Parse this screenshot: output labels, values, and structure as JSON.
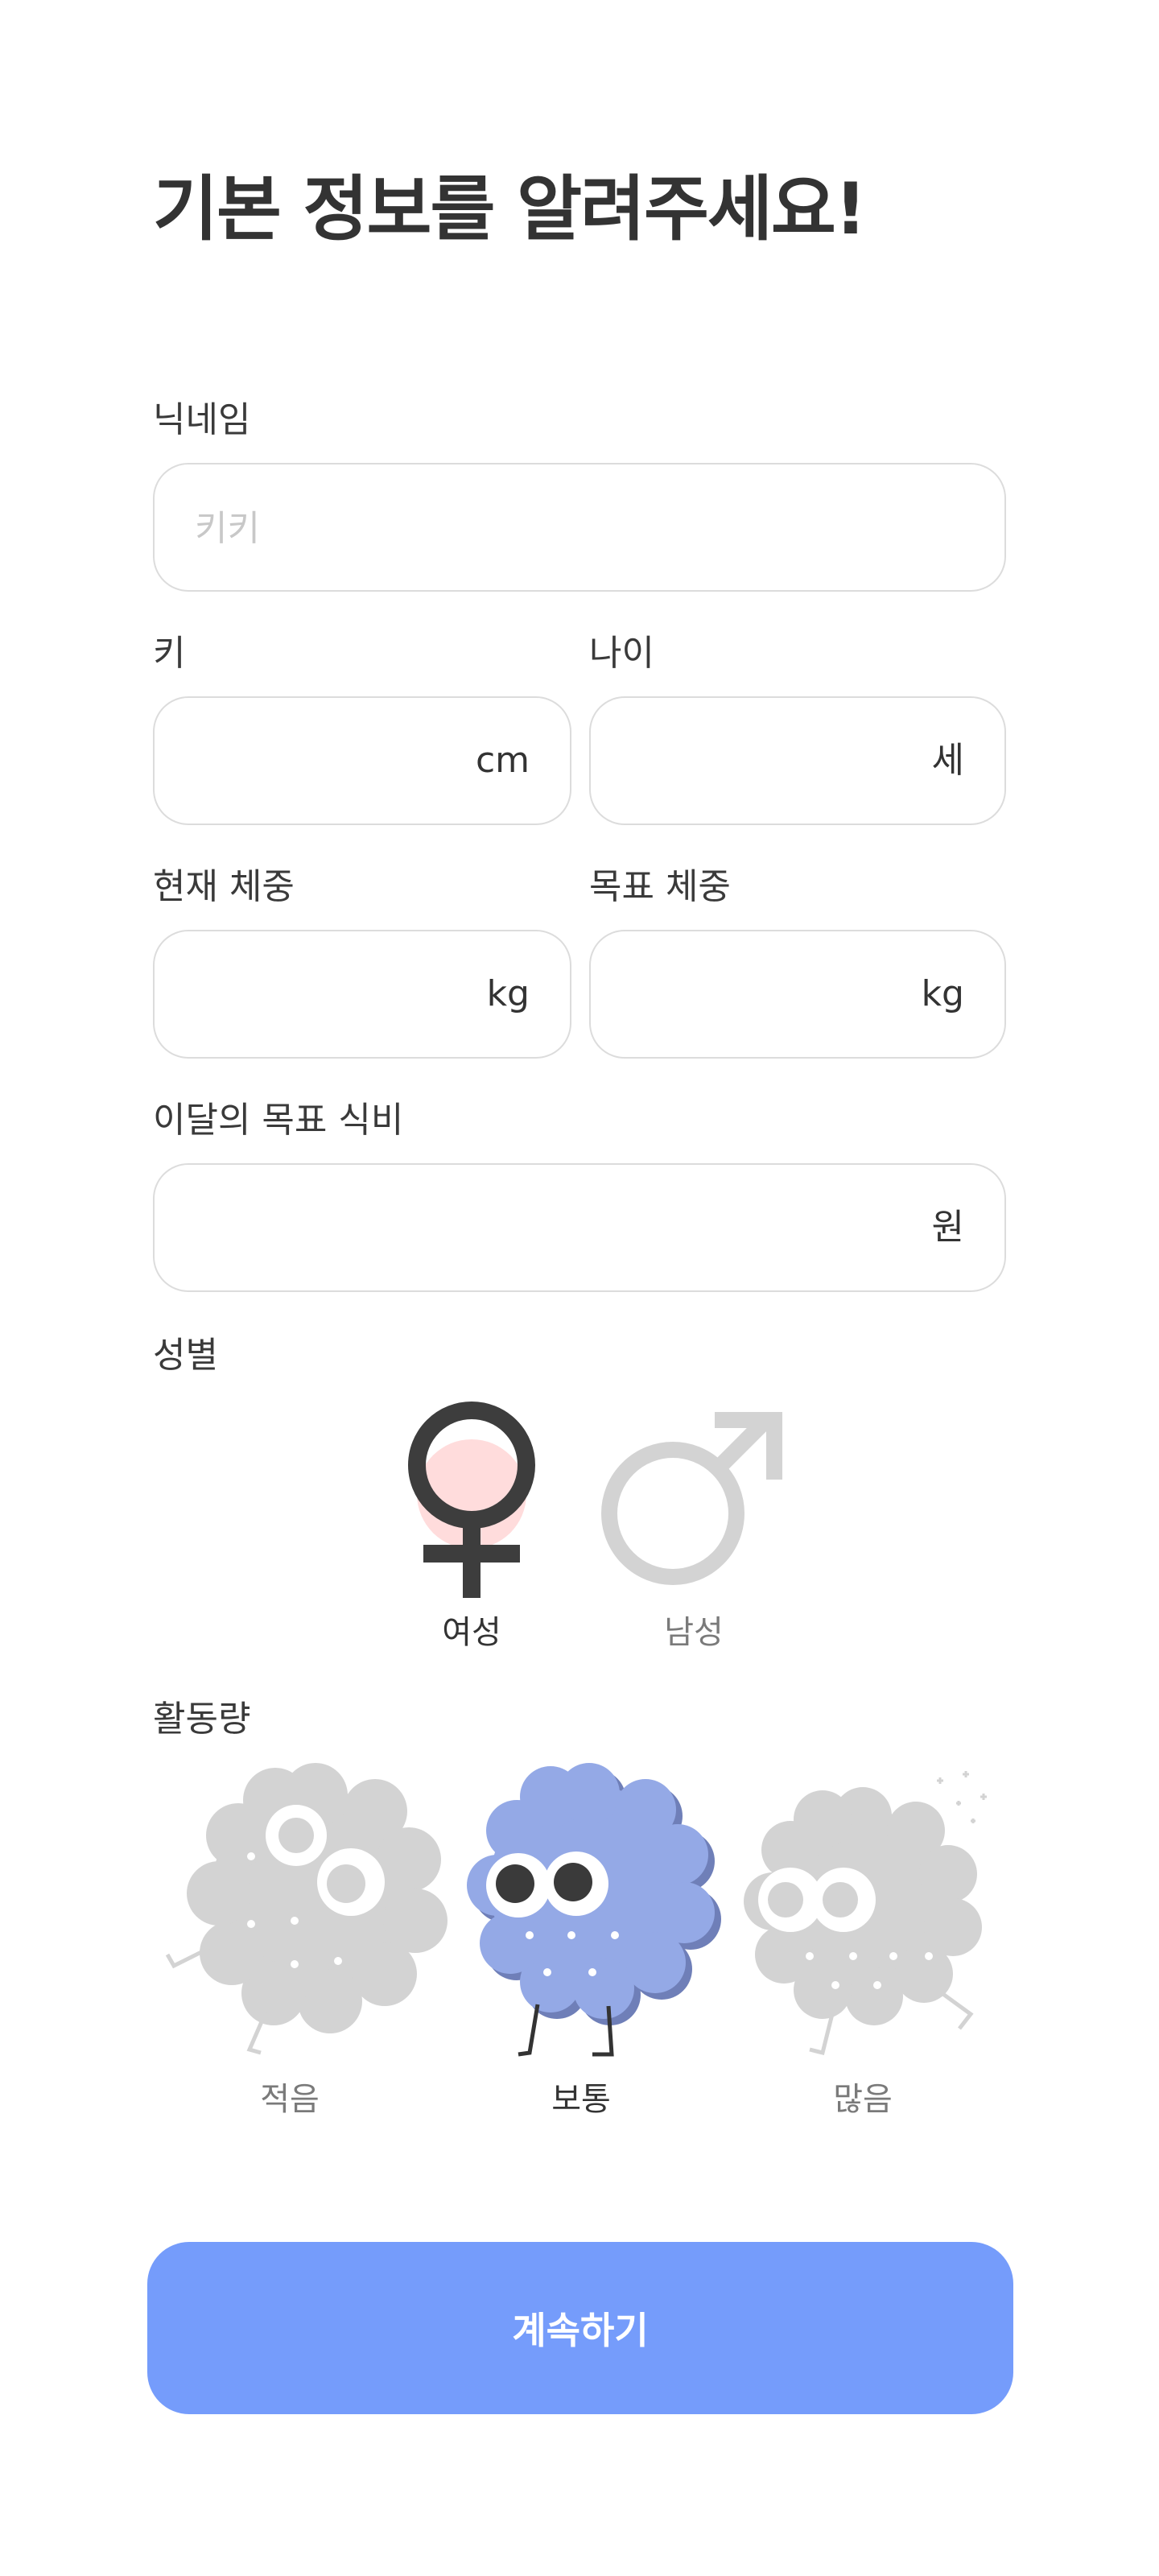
{
  "title": "기본 정보를 알려주세요!",
  "nickname": {
    "label": "닉네임",
    "value": "",
    "placeholder": "키키"
  },
  "height": {
    "label": "키",
    "value": "",
    "unit": "cm"
  },
  "age": {
    "label": "나이",
    "value": "",
    "unit": "세"
  },
  "current_weight": {
    "label": "현재 체중",
    "value": "",
    "unit": "kg"
  },
  "target_weight": {
    "label": "목표 체중",
    "value": "",
    "unit": "kg"
  },
  "monthly_budget": {
    "label": "이달의 목표 식비",
    "value": "",
    "unit": "원"
  },
  "gender": {
    "label": "성별",
    "selected": "female",
    "options": [
      {
        "id": "female",
        "label": "여성",
        "icon": "female-symbol-icon"
      },
      {
        "id": "male",
        "label": "남성",
        "icon": "male-symbol-icon"
      }
    ]
  },
  "activity": {
    "label": "활동량",
    "selected": "normal",
    "options": [
      {
        "id": "low",
        "label": "적음",
        "icon": "fluffy-character-lazy-icon"
      },
      {
        "id": "normal",
        "label": "보통",
        "icon": "fluffy-character-walking-icon"
      },
      {
        "id": "high",
        "label": "많음",
        "icon": "fluffy-character-running-icon"
      }
    ]
  },
  "continue_label": "계속하기",
  "colors": {
    "accent": "#759cfb",
    "selected_character": "#94a9e6",
    "unselected": "#d3d3d3",
    "female_highlight": "#ffdcdc",
    "text_dark": "#333333",
    "text_muted": "#7a7a7a"
  }
}
